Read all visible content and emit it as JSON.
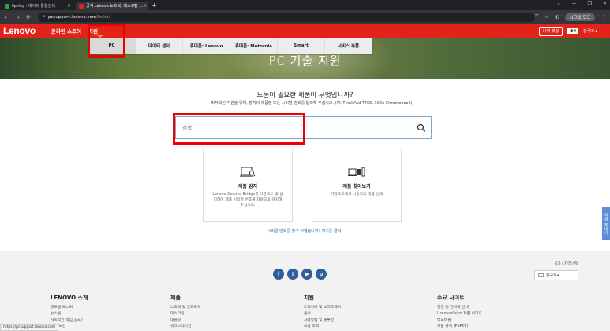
{
  "browser": {
    "tabs": [
      {
        "label": "lipslog : 데이터 통합검색",
        "active": false,
        "favicon_color": "#1fa84f"
      },
      {
        "label": "공식 Lenovo 노트북, 데스크탑 ...",
        "active": true,
        "favicon_color": "#e2231a"
      }
    ],
    "close_glyph": "×",
    "newtab_glyph": "+",
    "window_controls": [
      "⌄",
      "—",
      "❐",
      "✕"
    ],
    "url_host": "pcsupport.lenovo.com",
    "url_path": "/kr/ko/",
    "profile_label": "시크릿 모드",
    "icons": [
      "back-icon",
      "forward-icon",
      "reload-icon",
      "lock-icon",
      "key-icon",
      "star-icon",
      "sidebar-icon",
      "menu-icon"
    ]
  },
  "header": {
    "logo": "Lenovo",
    "nav": [
      "온라인 스토어",
      "지원"
    ],
    "my_account": "나의 계정",
    "flag_label": "▣ ▾",
    "language": "한국어 ▾",
    "brand_color": "#e2231a"
  },
  "subnav": {
    "items": [
      "PC",
      "데이터 센터",
      "휴대폰: Lenovo",
      "휴대폰: Motorola",
      "Smart",
      "서비스 부품"
    ],
    "selected": "PC"
  },
  "hero": {
    "title": "PC 기술 지원"
  },
  "main": {
    "question": "도움이 필요한 제품이 무엇입니까?",
    "hint": "최적화된 지원을 위해, 장치의 제품명 또는 시리얼 번호를 입력해 주십시오. (예: ThinkPad T495, 100e Chromebook)",
    "search_placeholder": "검색",
    "cards": [
      {
        "title": "제품 감지",
        "desc": "Lenovo Service Bridge를 다운로드 및 설치하여 제품 시리얼 번호를 자동으로 감지해 주십시오.",
        "icon": "laptop-search-icon"
      },
      {
        "title": "제품 찾아보기",
        "desc": "카탈로그에서 사용자의 제품 선택",
        "icon": "devices-icon"
      }
    ],
    "serial_link": "시리얼 번호를 찾기 어렵습니까? 여기를 클릭!",
    "feedback_label": "의견 보내기"
  },
  "footer": {
    "region_label": "국가 / 지역 선택",
    "region_value": "한국어 ▾",
    "social": [
      "f",
      "t",
      "▶",
      "p"
    ],
    "columns": [
      {
        "head": "LENOVO 소개",
        "links": [
          "글로벌 레노버",
          "뉴스룸",
          "사회적인 책임(공표)",
          "지역/보안"
        ]
      },
      {
        "head": "제품",
        "links": [
          "노트북 및 울트라북",
          "데스크탑",
          "태블릿",
          "워크스테이션"
        ]
      },
      {
        "head": "지원",
        "links": [
          "드라이버 및 소프트웨어",
          "문서",
          "사용방법 및 솔루션",
          "보증 조회"
        ]
      },
      {
        "head": "주요 사이트",
        "links": [
          "충전 및 관리에 안내",
          "LenovoVision 제품 비디오",
          "레노버몰",
          "제품 규격 (PSREF)"
        ]
      }
    ]
  },
  "status_url": "https://pcsupport.lenovo.com"
}
